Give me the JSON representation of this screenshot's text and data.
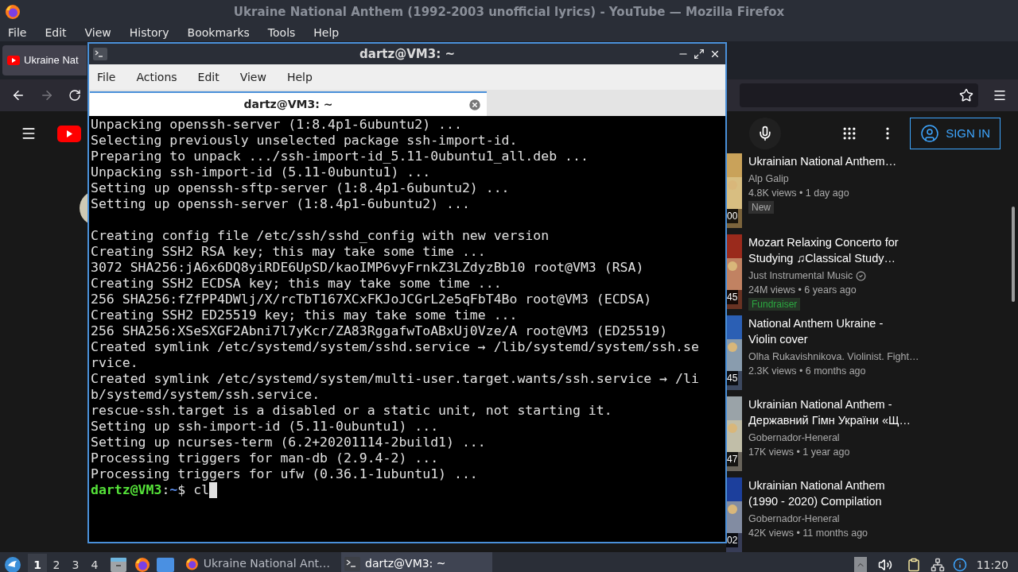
{
  "firefox": {
    "title": "Ukraine National Anthem (1992-2003 unofficial lyrics) - YouTube — Mozilla Firefox",
    "menu": [
      "File",
      "Edit",
      "View",
      "History",
      "Bookmarks",
      "Tools",
      "Help"
    ],
    "tab": {
      "label": "Ukraine Nat"
    },
    "youtube": {
      "sign_in": "SIGN IN",
      "videos": [
        {
          "duration": "00",
          "title": "Ukrainian National Anthem…",
          "channel": "Alp Galip",
          "verified": false,
          "meta": "4.8K views • 1 day ago",
          "badge": {
            "kind": "new",
            "label": "New"
          }
        },
        {
          "duration": "45",
          "title": "Mozart Relaxing Concerto for\nStudying ♫Classical Study…",
          "channel": "Just Instrumental Music",
          "verified": true,
          "meta": "24M views • 6 years ago",
          "badge": {
            "kind": "fundraiser",
            "label": "Fundraiser"
          }
        },
        {
          "duration": "45",
          "title": "National Anthem Ukraine -\nViolin cover",
          "channel": "Olha Rukavishnikova. Violinist. Fight…",
          "verified": false,
          "meta": "2.3K views • 6 months ago"
        },
        {
          "duration": "47",
          "title": "Ukrainian National Anthem -\nДержавний Гімн України «Щ…",
          "channel": "Gobernador-Heneral",
          "verified": false,
          "meta": "17K views • 1 year ago"
        },
        {
          "duration": "02",
          "title": "Ukrainian National Anthem\n(1990 - 2020) Compilation",
          "channel": "Gobernador-Heneral",
          "verified": false,
          "meta": "42K views • 11 months ago"
        }
      ]
    }
  },
  "terminal": {
    "title": "dartz@VM3: ~",
    "menu": [
      "File",
      "Actions",
      "Edit",
      "View",
      "Help"
    ],
    "tab": "dartz@VM3: ~",
    "blocks": [
      [
        "Unpacking openssh-server (1:8.4p1-6ubuntu2) ...",
        "Selecting previously unselected package ssh-import-id.",
        "Preparing to unpack .../ssh-import-id_5.11-0ubuntu1_all.deb ...",
        "Unpacking ssh-import-id (5.11-0ubuntu1) ...",
        "Setting up openssh-sftp-server (1:8.4p1-6ubuntu2) ...",
        "Setting up openssh-server (1:8.4p1-6ubuntu2) ..."
      ],
      [
        "Creating config file /etc/ssh/sshd_config with new version",
        "Creating SSH2 RSA key; this may take some time ...",
        "3072 SHA256:jA6x6DQ8yiRDE6UpSD/kaoIMP6vyFrnkZ3LZdyzBb10 root@VM3 (RSA)",
        "Creating SSH2 ECDSA key; this may take some time ...",
        "256 SHA256:fZfPP4DWlj/X/rcTbT167XCxFKJoJCGrL2e5qFbT4Bo root@VM3 (ECDSA)",
        "Creating SSH2 ED25519 key; this may take some time ...",
        "256 SHA256:XSeSXGF2Abni7l7yKcr/ZA83RggafwToABxUj0Vze/A root@VM3 (ED25519)",
        "Created symlink /etc/systemd/system/sshd.service → /lib/systemd/system/ssh.se",
        "rvice.",
        "Created symlink /etc/systemd/system/multi-user.target.wants/ssh.service → /li",
        "b/systemd/system/ssh.service.",
        "rescue-ssh.target is a disabled or a static unit, not starting it.",
        "Setting up ssh-import-id (5.11-0ubuntu1) ...",
        "Setting up ncurses-term (6.2+20201114-2build1) ...",
        "Processing triggers for man-db (2.9.4-2) ...",
        "Processing triggers for ufw (0.36.1-1ubuntu1) ..."
      ]
    ],
    "prompt": {
      "user_host": "dartz@VM3",
      "colon": ":",
      "path": "~",
      "symbol": "$",
      "input": "cl"
    }
  },
  "taskbar": {
    "workspaces": [
      {
        "label": "1",
        "selected": true
      },
      {
        "label": "2",
        "selected": false
      },
      {
        "label": "3",
        "selected": false
      },
      {
        "label": "4",
        "selected": false
      }
    ],
    "tasks": [
      {
        "kind": "browser",
        "label": "Ukraine National Ant…",
        "selected": false
      },
      {
        "kind": "terminal",
        "label": "dartz@VM3: ~",
        "selected": true
      }
    ],
    "clock": "11:20"
  }
}
